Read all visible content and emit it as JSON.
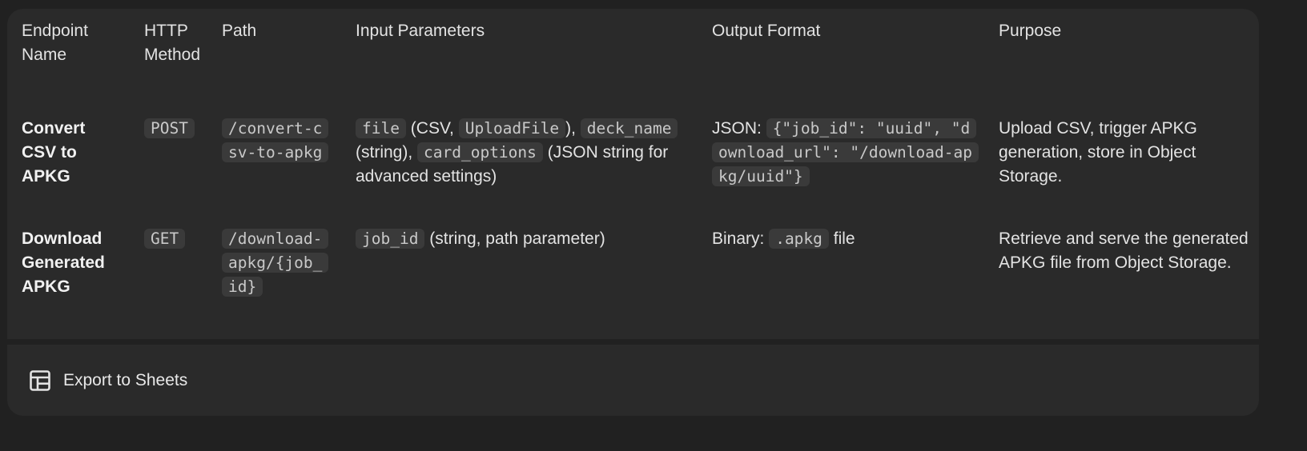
{
  "table": {
    "headers": [
      "Endpoint Name",
      "HTTP Method",
      "Path",
      "Input Parameters",
      "Output Format",
      "Purpose"
    ],
    "rows": [
      {
        "name": "Convert CSV to APKG",
        "method": "POST",
        "path": "/convert-csv-to-apkg",
        "input": {
          "p1_code": "file",
          "p1_text": " (CSV, ",
          "p2_code": "UploadFile",
          "p2_text": "), ",
          "p3_code": "deck_name",
          "p3_text": " (string), ",
          "p4_code": "card_options",
          "p4_text": " (JSON string for advanced settings)"
        },
        "output": {
          "prefix": "JSON: ",
          "code": "{\"job_id\": \"uuid\", \"download_url\": \"/download-apkg/uuid\"}"
        },
        "purpose": "Upload CSV, trigger APKG generation, store in Object Storage."
      },
      {
        "name": "Download Generated APKG",
        "method": "GET",
        "path": "/download-apkg/{job_id}",
        "input": {
          "p1_code": "job_id",
          "p1_text": " (string, path parameter)"
        },
        "output": {
          "prefix": "Binary: ",
          "code": ".apkg",
          "suffix": " file"
        },
        "purpose": "Retrieve and serve the generated APKG file from Object Storage."
      }
    ]
  },
  "footer": {
    "export_label": "Export to Sheets",
    "export_icon": "sheets-table-icon"
  }
}
